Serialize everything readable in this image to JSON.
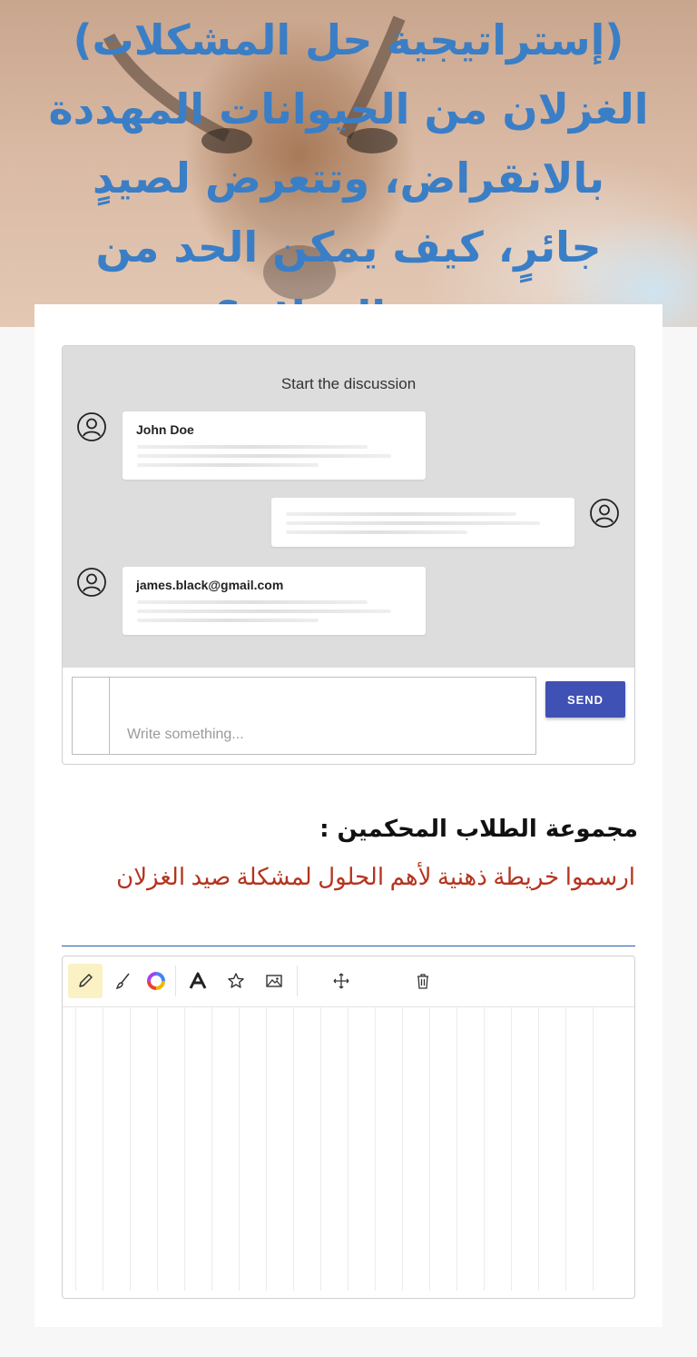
{
  "hero": {
    "title_lines": [
      "(إستراتيجية حل المشكلات)",
      "الغزلان من الحيوانات المهددة",
      "بالانقراض، وتتعرض لصيدٍ",
      "جائرٍ، كيف يمكن الحد من",
      "صيد الغزلان؟"
    ]
  },
  "discussion": {
    "title": "Start the discussion",
    "messages": [
      {
        "author": "John Doe",
        "side": "left"
      },
      {
        "author": "",
        "side": "right"
      },
      {
        "author": "james.black@gmail.com",
        "side": "left"
      }
    ],
    "input_placeholder": "Write something...",
    "send_label": "SEND"
  },
  "group": {
    "heading": "مجموعة الطلاب المحكمين :",
    "task": "ارسموا خريطة ذهنية لأهم الحلول لمشكلة صيد الغزلان"
  },
  "whiteboard": {
    "tools": [
      "pencil-icon",
      "brush-icon",
      "color-wheel-icon",
      "text-icon",
      "star-icon",
      "image-icon",
      "move-icon",
      "trash-icon"
    ],
    "active_tool": "pencil-icon",
    "highlight_color": "#faf1c4"
  },
  "colors": {
    "hero_text": "#3a7ec6",
    "send_button": "#3f51b5",
    "task_text": "#b5341f",
    "divider": "#1f5fa8"
  }
}
